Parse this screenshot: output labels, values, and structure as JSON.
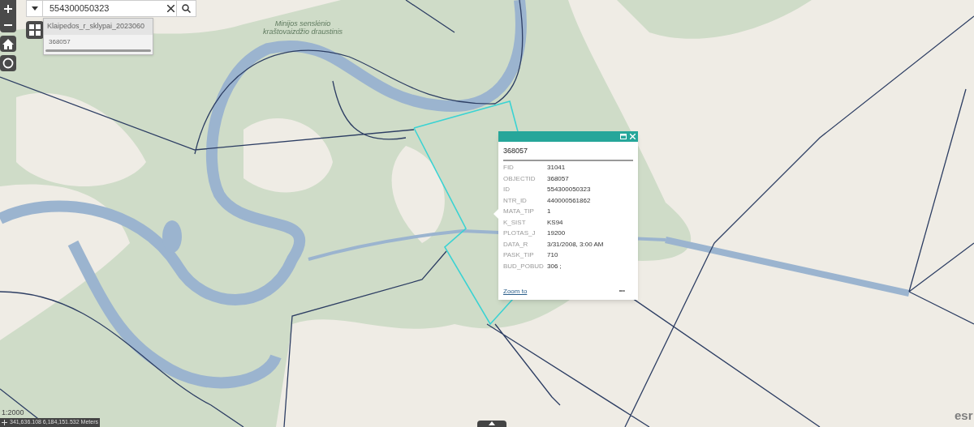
{
  "search": {
    "value": "554300050323"
  },
  "suggestions": {
    "layer": "Klaipedos_r_sklypai_2023060",
    "items": [
      "368057"
    ]
  },
  "map_label": "Minijos senslėnio kraštovaizdžio draustinis",
  "popup": {
    "title": "368057",
    "fields": [
      {
        "name": "FID",
        "value": "31041"
      },
      {
        "name": "OBJECTID",
        "value": "368057"
      },
      {
        "name": "ID",
        "value": "554300050323"
      },
      {
        "name": "NTR_ID",
        "value": "440000561862"
      },
      {
        "name": "MATA_TIP",
        "value": "1"
      },
      {
        "name": "K_SIST",
        "value": "KS94"
      },
      {
        "name": "PLOTAS_J",
        "value": "19200"
      },
      {
        "name": "DATA_R",
        "value": "3/31/2008, 3:00 AM"
      },
      {
        "name": "PASK_TIP",
        "value": "710"
      },
      {
        "name": "BUD_POBUD",
        "value": "306 ;"
      }
    ],
    "action": "Zoom to",
    "more": "•••"
  },
  "scale": "1:2000",
  "coordinates": "341,636.108 6,184,151.532 Meters",
  "attribution": "esr"
}
